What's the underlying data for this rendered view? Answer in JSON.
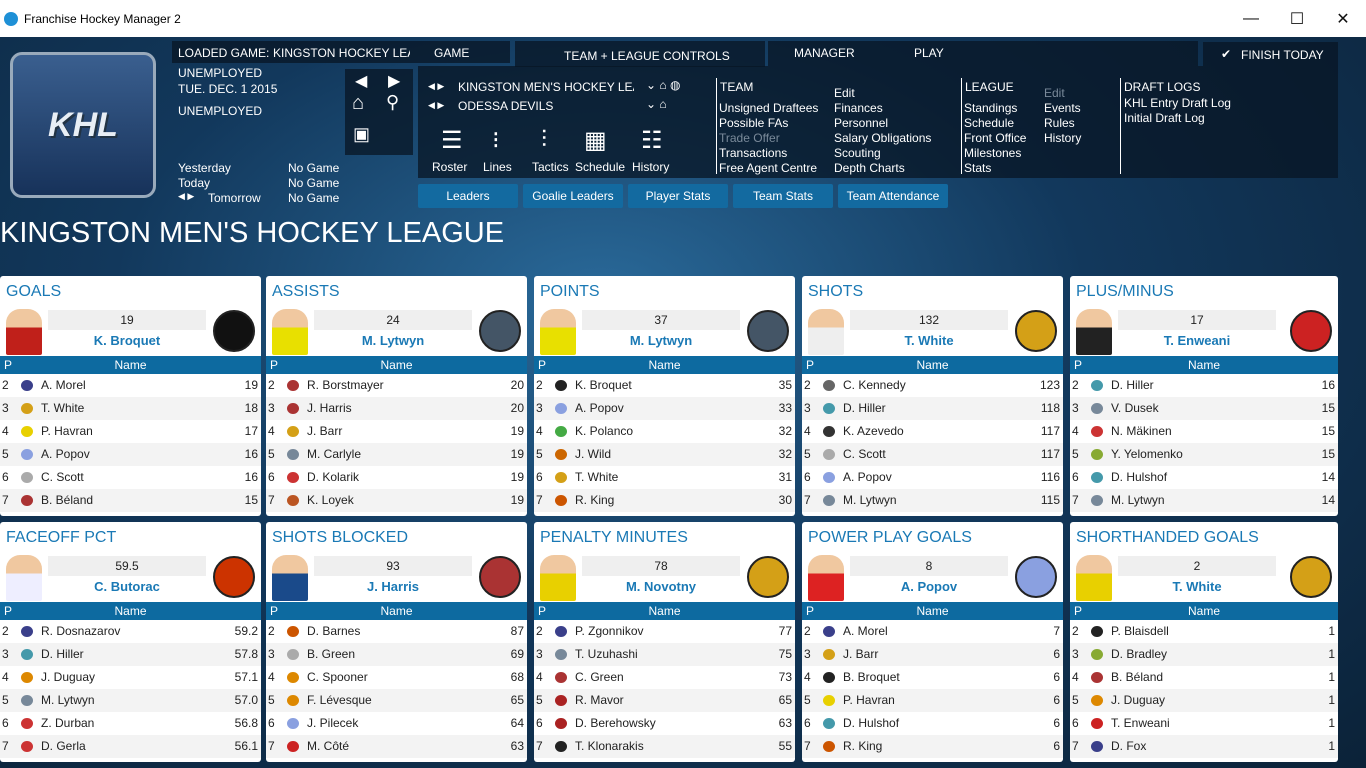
{
  "window": {
    "title": "Franchise Hockey Manager 2",
    "minimize": "—",
    "maximize": "☐",
    "close": "✕"
  },
  "header": {
    "loaded_label": "LOADED GAME:",
    "loaded_value": "KINGSTON HOCKEY LEA",
    "tab_game": "GAME",
    "tab_controls": "TEAM + LEAGUE CONTROLS",
    "tab_manager": "MANAGER",
    "tab_play": "PLAY",
    "finish": "FINISH TODAY",
    "status1": "UNEMPLOYED",
    "date": "TUE. DEC. 1 2015",
    "status2": "UNEMPLOYED",
    "schedule": [
      {
        "label": "Yesterday",
        "value": "No Game"
      },
      {
        "label": "Today",
        "value": "No Game"
      },
      {
        "label": "Tomorrow",
        "value": "No Game"
      }
    ],
    "league_selector": "KINGSTON MEN'S HOCKEY LEA",
    "team_selector": "ODESSA DEVILS",
    "tools": [
      "Roster",
      "Lines",
      "Tactics",
      "Schedule",
      "History"
    ],
    "team_menu": {
      "title": "TEAM",
      "col1": [
        "Unsigned Draftees",
        "Possible FAs",
        "Trade Offer",
        "Transactions",
        "Free Agent Centre"
      ],
      "col2": [
        "Edit",
        "Finances",
        "Personnel",
        "Salary Obligations",
        "Scouting",
        "Depth Charts"
      ]
    },
    "league_menu": {
      "title": "LEAGUE",
      "col1": [
        "Standings",
        "Schedule",
        "Front Office",
        "Milestones",
        "Stats"
      ],
      "col2": [
        "Edit",
        "Events",
        "Rules",
        "History"
      ]
    },
    "draft_menu": {
      "title": "DRAFT LOGS",
      "items": [
        "KHL Entry Draft Log",
        "Initial Draft Log"
      ]
    },
    "subtabs": [
      "Leaders",
      "Goalie Leaders",
      "Player Stats",
      "Team Stats",
      "Team Attendance"
    ],
    "logo_text": "KHL"
  },
  "page_title": "KINGSTON MEN'S HOCKEY LEAGUE",
  "table_headers": {
    "p": "P",
    "name": "Name"
  },
  "panels": [
    {
      "title": "GOALS",
      "value": "19",
      "leader": "K. Broquet",
      "jersey": "#c0201a",
      "team_color": "#111",
      "rows": [
        [
          "2",
          "A. Morel",
          "19",
          "#3a3f8a"
        ],
        [
          "3",
          "T. White",
          "18",
          "#d4a017"
        ],
        [
          "4",
          "P. Havran",
          "17",
          "#e8d000"
        ],
        [
          "5",
          "A. Popov",
          "16",
          "#8aa0e0"
        ],
        [
          "6",
          "C. Scott",
          "16",
          "#aaa"
        ],
        [
          "7",
          "B. Béland",
          "15",
          "#a33"
        ]
      ]
    },
    {
      "title": "ASSISTS",
      "value": "24",
      "leader": "M. Lytwyn",
      "jersey": "#e8e000",
      "team_color": "#456",
      "rows": [
        [
          "2",
          "R. Borstmayer",
          "20",
          "#a33"
        ],
        [
          "3",
          "J. Harris",
          "20",
          "#a33"
        ],
        [
          "4",
          "J. Barr",
          "19",
          "#d4a017"
        ],
        [
          "5",
          "M. Carlyle",
          "19",
          "#789"
        ],
        [
          "6",
          "D. Kolarik",
          "19",
          "#c33"
        ],
        [
          "7",
          "K. Loyek",
          "19",
          "#b52"
        ]
      ]
    },
    {
      "title": "POINTS",
      "value": "37",
      "leader": "M. Lytwyn",
      "jersey": "#e8e000",
      "team_color": "#456",
      "rows": [
        [
          "2",
          "K. Broquet",
          "35",
          "#222"
        ],
        [
          "3",
          "A. Popov",
          "33",
          "#8aa0e0"
        ],
        [
          "4",
          "K. Polanco",
          "32",
          "#4a4"
        ],
        [
          "5",
          "J. Wild",
          "32",
          "#c60"
        ],
        [
          "6",
          "T. White",
          "31",
          "#d4a017"
        ],
        [
          "7",
          "R. King",
          "30",
          "#c50"
        ]
      ]
    },
    {
      "title": "SHOTS",
      "value": "132",
      "leader": "T. White",
      "jersey": "#eee",
      "team_color": "#d4a017",
      "rows": [
        [
          "2",
          "C. Kennedy",
          "123",
          "#666"
        ],
        [
          "3",
          "D. Hiller",
          "118",
          "#49a"
        ],
        [
          "4",
          "K. Azevedo",
          "117",
          "#333"
        ],
        [
          "5",
          "C. Scott",
          "117",
          "#aaa"
        ],
        [
          "6",
          "A. Popov",
          "116",
          "#8aa0e0"
        ],
        [
          "7",
          "M. Lytwyn",
          "115",
          "#789"
        ]
      ]
    },
    {
      "title": "PLUS/MINUS",
      "value": "17",
      "leader": "T. Enweani",
      "jersey": "#222",
      "team_color": "#c22",
      "rows": [
        [
          "2",
          "D. Hiller",
          "16",
          "#49a"
        ],
        [
          "3",
          "V. Dusek",
          "15",
          "#789"
        ],
        [
          "4",
          "N. Mäkinen",
          "15",
          "#c33"
        ],
        [
          "5",
          "Y. Yelomenko",
          "15",
          "#8a3"
        ],
        [
          "6",
          "D. Hulshof",
          "14",
          "#49a"
        ],
        [
          "7",
          "M. Lytwyn",
          "14",
          "#789"
        ]
      ]
    },
    {
      "title": "FACEOFF PCT",
      "value": "59.5",
      "leader": "C. Butorac",
      "jersey": "#eef",
      "team_color": "#c30",
      "rows": [
        [
          "2",
          "R. Dosnazarov",
          "59.2",
          "#3a3f8a"
        ],
        [
          "3",
          "D. Hiller",
          "57.8",
          "#49a"
        ],
        [
          "4",
          "J. Duguay",
          "57.1",
          "#d80"
        ],
        [
          "5",
          "M. Lytwyn",
          "57.0",
          "#789"
        ],
        [
          "6",
          "Z. Durban",
          "56.8",
          "#c33"
        ],
        [
          "7",
          "D. Gerla",
          "56.1",
          "#c33"
        ]
      ]
    },
    {
      "title": "SHOTS BLOCKED",
      "value": "93",
      "leader": "J. Harris",
      "jersey": "#1a4a8a",
      "team_color": "#a33",
      "rows": [
        [
          "2",
          "D. Barnes",
          "87",
          "#c50"
        ],
        [
          "3",
          "B. Green",
          "69",
          "#aaa"
        ],
        [
          "4",
          "C. Spooner",
          "68",
          "#d80"
        ],
        [
          "5",
          "F. Lévesque",
          "65",
          "#d80"
        ],
        [
          "6",
          "J. Pilecek",
          "64",
          "#8aa0e0"
        ],
        [
          "7",
          "M. Côté",
          "63",
          "#c22"
        ]
      ]
    },
    {
      "title": "PENALTY MINUTES",
      "value": "78",
      "leader": "M. Novotny",
      "jersey": "#e8d000",
      "team_color": "#d4a017",
      "rows": [
        [
          "2",
          "P. Zgonnikov",
          "77",
          "#3a3f8a"
        ],
        [
          "3",
          "T. Uzuhashi",
          "75",
          "#789"
        ],
        [
          "4",
          "C. Green",
          "73",
          "#a33"
        ],
        [
          "5",
          "R. Mavor",
          "65",
          "#a22"
        ],
        [
          "6",
          "D. Berehowsky",
          "63",
          "#a22"
        ],
        [
          "7",
          "T. Klonarakis",
          "55",
          "#222"
        ]
      ]
    },
    {
      "title": "POWER PLAY GOALS",
      "value": "8",
      "leader": "A. Popov",
      "jersey": "#d22",
      "team_color": "#8aa0e0",
      "rows": [
        [
          "2",
          "A. Morel",
          "7",
          "#3a3f8a"
        ],
        [
          "3",
          "J. Barr",
          "6",
          "#d4a017"
        ],
        [
          "4",
          "B. Broquet",
          "6",
          "#222"
        ],
        [
          "5",
          "P. Havran",
          "6",
          "#e8d000"
        ],
        [
          "6",
          "D. Hulshof",
          "6",
          "#49a"
        ],
        [
          "7",
          "R. King",
          "6",
          "#c50"
        ]
      ]
    },
    {
      "title": "SHORTHANDED GOALS",
      "value": "2",
      "leader": "T. White",
      "jersey": "#e8d000",
      "team_color": "#d4a017",
      "rows": [
        [
          "2",
          "P. Blaisdell",
          "1",
          "#222"
        ],
        [
          "3",
          "D. Bradley",
          "1",
          "#8a3"
        ],
        [
          "4",
          "B. Béland",
          "1",
          "#a33"
        ],
        [
          "5",
          "J. Duguay",
          "1",
          "#d80"
        ],
        [
          "6",
          "T. Enweani",
          "1",
          "#c22"
        ],
        [
          "7",
          "D. Fox",
          "1",
          "#3a3f8a"
        ]
      ]
    }
  ]
}
